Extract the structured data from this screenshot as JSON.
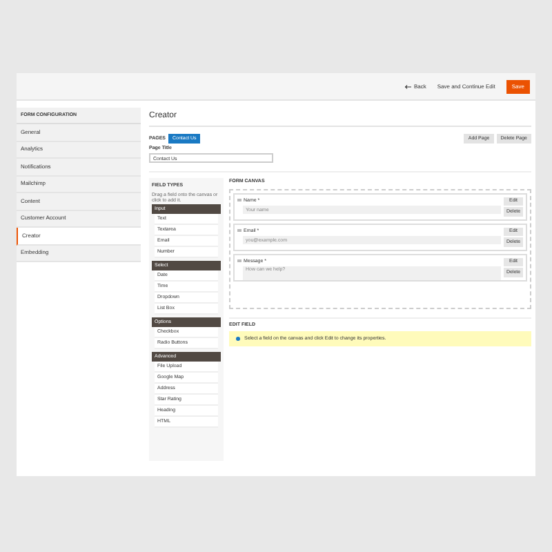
{
  "header": {
    "back": "Back",
    "save_continue": "Save and Continue Edit",
    "save": "Save"
  },
  "sidebar": {
    "title": "FORM CONFIGURATION",
    "items": [
      {
        "label": "General",
        "selected": false
      },
      {
        "label": "Analytics",
        "selected": false
      },
      {
        "label": "Notifications",
        "selected": false
      },
      {
        "label": "Mailchimp",
        "selected": false
      },
      {
        "label": "Content",
        "selected": false
      },
      {
        "label": "Customer Account",
        "selected": false
      },
      {
        "label": "Creator",
        "selected": true
      },
      {
        "label": "Embedding",
        "selected": false
      }
    ]
  },
  "main": {
    "title": "Creator",
    "pages_label": "PAGES",
    "pages": [
      {
        "label": "Contact Us",
        "selected": true
      }
    ],
    "add_page": "Add Page",
    "delete_page": "Delete Page",
    "page_title_label": "Page Title",
    "page_title_value": "Contact Us"
  },
  "field_types": {
    "title": "FIELD TYPES",
    "hint": "Drag a field onto the canvas or click to add it.",
    "groups": [
      {
        "name": "Input",
        "items": [
          "Text",
          "Textarea",
          "Email",
          "Number"
        ]
      },
      {
        "name": "Select",
        "items": [
          "Date",
          "Time",
          "Dropdown",
          "List Box"
        ]
      },
      {
        "name": "Options",
        "items": [
          "Checkbox",
          "Radio Buttons"
        ]
      },
      {
        "name": "Advanced",
        "items": [
          "File Upload",
          "Google Map",
          "Address",
          "Star Rating",
          "Heading",
          "HTML"
        ]
      }
    ]
  },
  "form_canvas": {
    "title": "FORM CANVAS",
    "fields": [
      {
        "label": "Name *",
        "placeholder": "Your name",
        "kind": "input",
        "edit": "Edit",
        "delete": "Delete"
      },
      {
        "label": "Email *",
        "placeholder": "you@example.com",
        "kind": "input",
        "edit": "Edit",
        "delete": "Delete"
      },
      {
        "label": "Message *",
        "placeholder": "How can we help?",
        "kind": "textarea",
        "edit": "Edit",
        "delete": "Delete"
      }
    ]
  },
  "edit_field": {
    "title": "EDIT FIELD",
    "note": "Select a field on the canvas and click Edit to change its properties."
  }
}
